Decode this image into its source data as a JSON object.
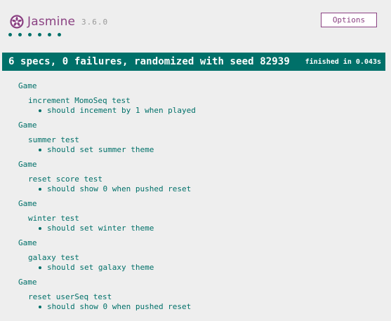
{
  "header": {
    "logo_text": "Jasmine",
    "version": "3.6.0",
    "options_label": "Options",
    "brand_color": "#8a4182",
    "pass_color": "#007069",
    "passed_dots": 6
  },
  "summary": {
    "text": "6 specs, 0 failures, randomized with seed 82939",
    "duration": "finished in 0.043s"
  },
  "suites": [
    {
      "suite": "Game",
      "test": "increment MomoSeq test",
      "spec": "should incement by 1 when played"
    },
    {
      "suite": "Game",
      "test": "summer test",
      "spec": "should set summer theme"
    },
    {
      "suite": "Game",
      "test": "reset score test",
      "spec": "should show 0 when pushed reset"
    },
    {
      "suite": "Game",
      "test": "winter test",
      "spec": "should set winter theme"
    },
    {
      "suite": "Game",
      "test": "galaxy test",
      "spec": "should set galaxy theme"
    },
    {
      "suite": "Game",
      "test": "reset userSeq test",
      "spec": "should show 0 when pushed reset"
    }
  ]
}
